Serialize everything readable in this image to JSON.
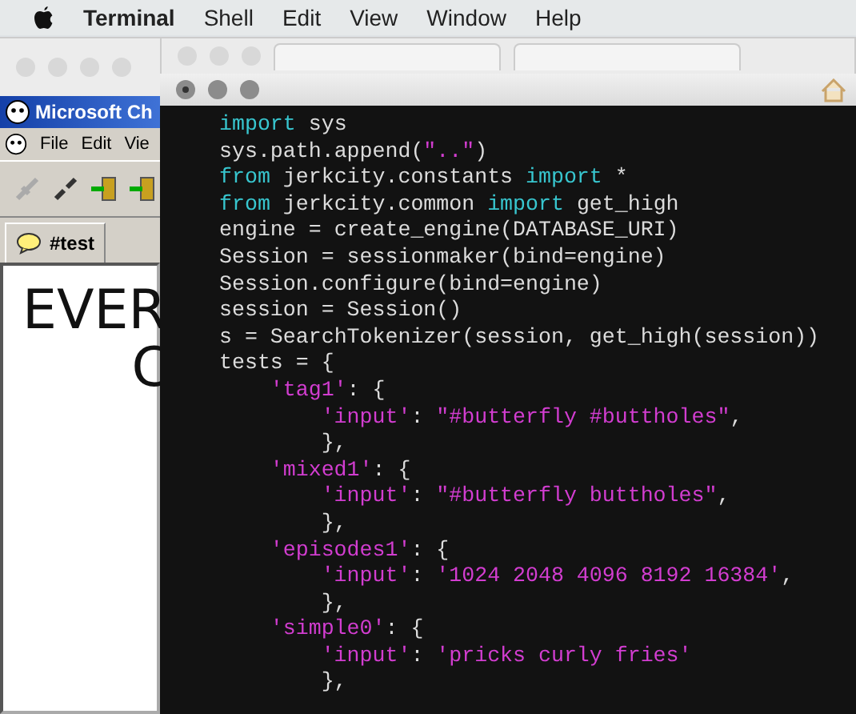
{
  "menubar": {
    "app": "Terminal",
    "items": [
      "Shell",
      "Edit",
      "View",
      "Window",
      "Help"
    ]
  },
  "chat_window": {
    "title": "Microsoft Ch",
    "menu": [
      "File",
      "Edit",
      "Vie"
    ],
    "tab": {
      "label": "#test",
      "selected": true
    },
    "content": [
      "EVER",
      "C"
    ]
  },
  "terminal": {
    "lines": [
      [
        {
          "kind": "keyword",
          "text": "import"
        },
        {
          "kind": "plain",
          "text": " sys"
        }
      ],
      [
        {
          "kind": "plain",
          "text": "sys.path.append("
        },
        {
          "kind": "string",
          "text": "\"..\""
        },
        {
          "kind": "plain",
          "text": ")"
        }
      ],
      [
        {
          "kind": "keyword",
          "text": "from"
        },
        {
          "kind": "plain",
          "text": " jerkcity.constants "
        },
        {
          "kind": "keyword",
          "text": "import"
        },
        {
          "kind": "plain",
          "text": " *"
        }
      ],
      [
        {
          "kind": "keyword",
          "text": "from"
        },
        {
          "kind": "plain",
          "text": " jerkcity.common "
        },
        {
          "kind": "keyword",
          "text": "import"
        },
        {
          "kind": "plain",
          "text": " get_high"
        }
      ],
      [
        {
          "kind": "plain",
          "text": "engine = create_engine(DATABASE_URI)"
        }
      ],
      [
        {
          "kind": "plain",
          "text": "Session = sessionmaker(bind=engine)"
        }
      ],
      [
        {
          "kind": "plain",
          "text": "Session.configure(bind=engine)"
        }
      ],
      [
        {
          "kind": "plain",
          "text": "session = Session()"
        }
      ],
      [
        {
          "kind": "plain",
          "text": "s = SearchTokenizer(session, get_high(session))"
        }
      ],
      [
        {
          "kind": "plain",
          "text": "tests = {"
        }
      ],
      [
        {
          "kind": "string",
          "text": "'tag1'"
        },
        {
          "kind": "plain",
          "text": ": {"
        }
      ],
      [
        {
          "kind": "string",
          "text": "'input'"
        },
        {
          "kind": "plain",
          "text": ": "
        },
        {
          "kind": "string",
          "text": "\"#butterfly #buttholes\""
        },
        {
          "kind": "plain",
          "text": ","
        }
      ],
      [
        {
          "kind": "plain",
          "text": "},"
        }
      ],
      [
        {
          "kind": "string",
          "text": "'mixed1'"
        },
        {
          "kind": "plain",
          "text": ": {"
        }
      ],
      [
        {
          "kind": "string",
          "text": "'input'"
        },
        {
          "kind": "plain",
          "text": ": "
        },
        {
          "kind": "string",
          "text": "\"#butterfly buttholes\""
        },
        {
          "kind": "plain",
          "text": ","
        }
      ],
      [
        {
          "kind": "plain",
          "text": "},"
        }
      ],
      [
        {
          "kind": "string",
          "text": "'episodes1'"
        },
        {
          "kind": "plain",
          "text": ": {"
        }
      ],
      [
        {
          "kind": "string",
          "text": "'input'"
        },
        {
          "kind": "plain",
          "text": ": "
        },
        {
          "kind": "string",
          "text": "'1024 2048 4096 8192 16384'"
        },
        {
          "kind": "plain",
          "text": ","
        }
      ],
      [
        {
          "kind": "plain",
          "text": "},"
        }
      ],
      [
        {
          "kind": "string",
          "text": "'simple0'"
        },
        {
          "kind": "plain",
          "text": ": {"
        }
      ],
      [
        {
          "kind": "string",
          "text": "'input'"
        },
        {
          "kind": "plain",
          "text": ": "
        },
        {
          "kind": "string",
          "text": "'pricks curly fries'"
        }
      ],
      [
        {
          "kind": "plain",
          "text": "},"
        }
      ]
    ]
  }
}
